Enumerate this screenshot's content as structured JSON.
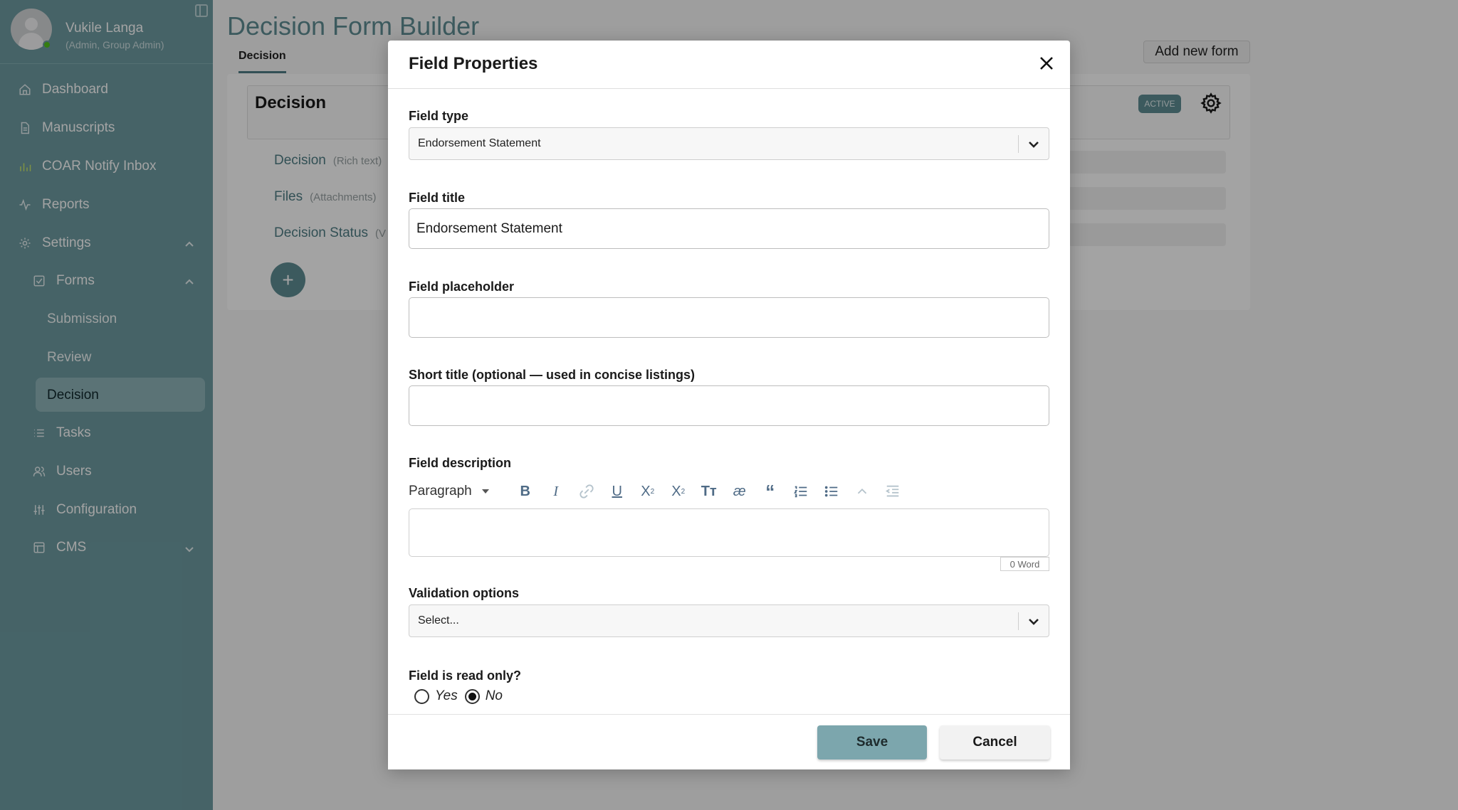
{
  "user": {
    "name": "Vukile Langa",
    "role": "(Admin, Group Admin)"
  },
  "sidebar": {
    "items": [
      {
        "label": "Dashboard",
        "icon": "home-icon"
      },
      {
        "label": "Manuscripts",
        "icon": "document-icon"
      },
      {
        "label": "COAR Notify Inbox",
        "icon": "chart-icon"
      },
      {
        "label": "Reports",
        "icon": "activity-icon"
      },
      {
        "label": "Settings",
        "icon": "gear-icon"
      },
      {
        "label": "Forms",
        "icon": "checkbox-icon"
      },
      {
        "label": "Submission"
      },
      {
        "label": "Review"
      },
      {
        "label": "Decision"
      },
      {
        "label": "Tasks",
        "icon": "list-icon"
      },
      {
        "label": "Users",
        "icon": "users-icon"
      },
      {
        "label": "Configuration",
        "icon": "sliders-icon"
      },
      {
        "label": "CMS",
        "icon": "layout-icon"
      }
    ]
  },
  "page": {
    "title": "Decision Form Builder",
    "tab": "Decision",
    "add_form_label": "Add new form",
    "form_name": "Decision",
    "status_badge": "ACTIVE",
    "fields": [
      {
        "name": "Decision",
        "kind": "(Rich text)"
      },
      {
        "name": "Files",
        "kind": "(Attachments)"
      },
      {
        "name": "Decision Status",
        "kind": "(V"
      }
    ],
    "add_field_label": "+"
  },
  "modal": {
    "title": "Field Properties",
    "field_type": {
      "label": "Field type",
      "value": "Endorsement Statement"
    },
    "field_title": {
      "label": "Field title",
      "value": "Endorsement Statement"
    },
    "field_placeholder": {
      "label": "Field placeholder",
      "value": ""
    },
    "short_title": {
      "label": "Short title (optional — used in concise listings)",
      "value": ""
    },
    "field_description": {
      "label": "Field description",
      "paragraph_style": "Paragraph",
      "word_count": "0 Word"
    },
    "validation": {
      "label": "Validation options",
      "value": "Select..."
    },
    "read_only": {
      "label": "Field is read only?",
      "yes": "Yes",
      "no": "No",
      "selected": "No"
    },
    "save_label": "Save",
    "cancel_label": "Cancel"
  },
  "colors": {
    "sidebar": "#6e9ca2",
    "accent": "#5f8d93",
    "save_button": "#7ca6ad"
  }
}
